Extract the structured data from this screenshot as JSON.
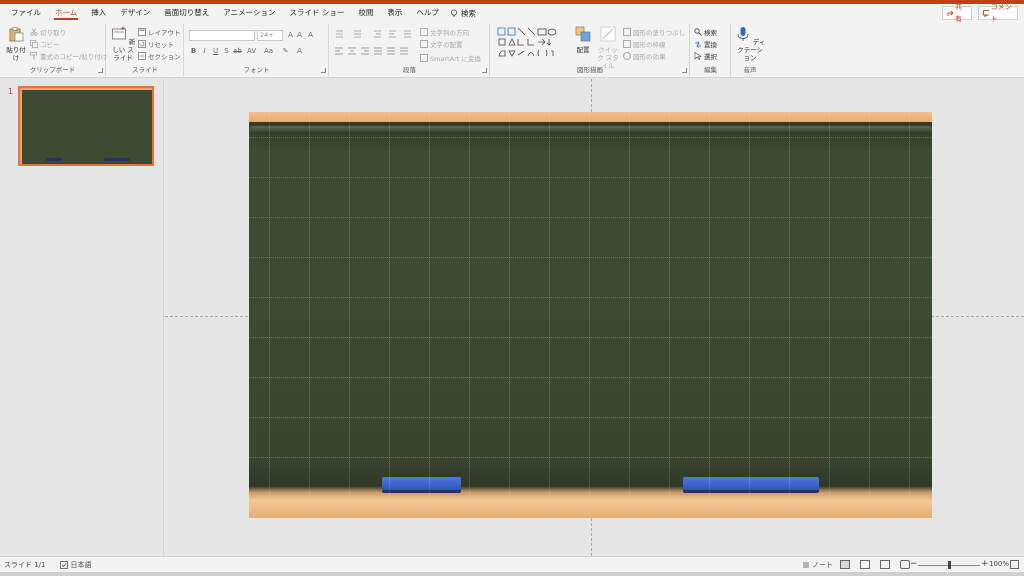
{
  "ribbon_tabs": [
    "ファイル",
    "ホーム",
    "挿入",
    "デザイン",
    "画面切り替え",
    "アニメーション",
    "スライド ショー",
    "校閲",
    "表示",
    "ヘルプ"
  ],
  "active_tab": "ホーム",
  "search_label": "検索",
  "share_label": "共有",
  "comment_label": "コメント",
  "clipboard": {
    "paste": "貼り付け",
    "cut": "切り取り",
    "copy": "コピー",
    "format_painter": "書式のコピー/貼り付け",
    "label": "クリップボード"
  },
  "slides_group": {
    "new_slide": "新しい スライド",
    "layout": "レイアウト",
    "reset": "リセット",
    "section": "セクション",
    "label": "スライド"
  },
  "font_group": {
    "font_name": "",
    "font_size": "24+",
    "label": "フォント"
  },
  "paragraph_group": {
    "text_direction": "文字列の方向",
    "align_text": "文字の配置",
    "smartart": "SmartArt に変換",
    "label": "段落"
  },
  "drawing_group": {
    "arrange": "配置",
    "quick_styles": "クイック スタイル",
    "shape_fill": "図形の塗りつぶし",
    "shape_outline": "図形の枠線",
    "shape_effects": "図形の効果",
    "label": "図形描画"
  },
  "editing_group": {
    "find": "検索",
    "replace": "置換",
    "select": "選択",
    "label": "編集"
  },
  "voice_group": {
    "dictate": "ディクテーション",
    "label": "音声"
  },
  "thumbnail": {
    "number": "1"
  },
  "status_bar": {
    "slide_info": "スライド 1/1",
    "language": "日本語",
    "notes": "ノート",
    "zoom": "100%"
  },
  "colors": {
    "accent": "#c43e1c",
    "chalkboard": "#3d4a33",
    "frame": "#ebb07a",
    "eraser": "#3f64c8"
  }
}
